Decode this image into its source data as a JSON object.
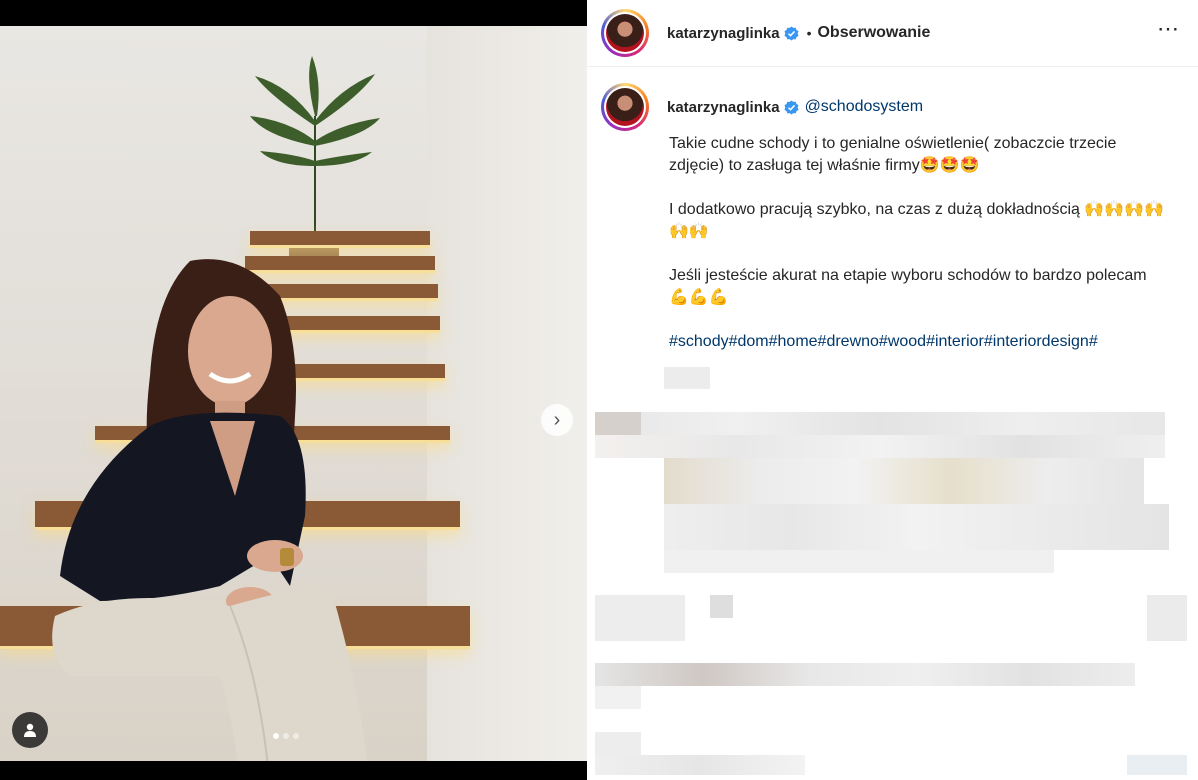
{
  "post": {
    "username": "katarzynaglinka",
    "separator": "•",
    "follow_label": "Obserwowanie",
    "more_icon": "⋯",
    "mention": "@schodosystem",
    "caption_p1": "Takie cudne schody i to genialne oświetlenie( zobaczcie trzecie zdjęcie) to zasługa tej właśnie firmy",
    "caption_p1_emoji": "🤩🤩🤩",
    "caption_p2": "I dodatkowo pracują szybko, na czas z dużą dokładnością ",
    "caption_p2_emoji": "🙌🙌🙌🙌🙌🙌",
    "caption_p3": "Jeśli jesteście akurat na etapie wyboru schodów to bardzo polecam ",
    "caption_p3_emoji": "💪💪💪",
    "hashtags": "#schody#dom#home#drewno#wood#interior#interiordesign#"
  },
  "media": {
    "next_icon": "›",
    "carousel_dots": 3,
    "active_dot": 0,
    "icons": {
      "next": "chevron-right-icon",
      "user_tag": "user-icon",
      "verified": "verified-badge-icon"
    }
  },
  "colors": {
    "link": "#00376b",
    "text": "#262626",
    "verified": "#3897f0"
  }
}
